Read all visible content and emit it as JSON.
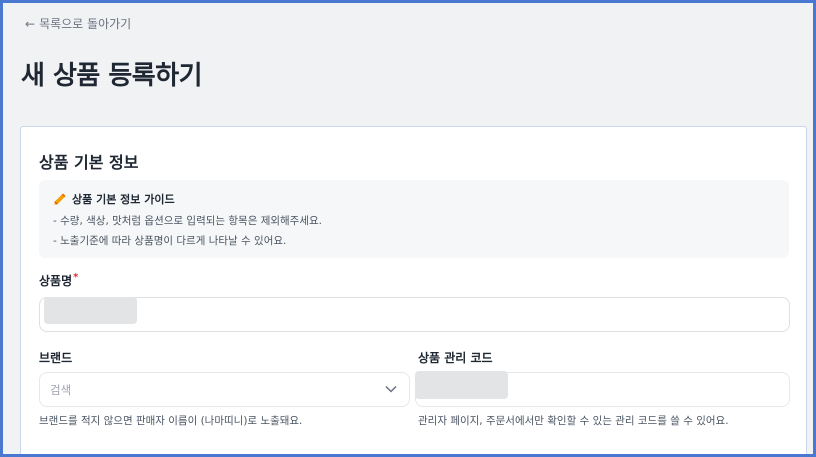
{
  "nav": {
    "back_arrow": "←",
    "back_label": "목록으로 돌아가기"
  },
  "page": {
    "title": "새 상품 등록하기"
  },
  "section": {
    "title": "상품 기본 정보",
    "guide": {
      "icon": "pencil-icon",
      "title": "상품 기본 정보 가이드",
      "lines": [
        "- 수량, 색상, 맛처럼 옵션으로 입력되는 항목은 제외해주세요.",
        "- 노출기준에 따라 상품명이 다르게 나타날 수 있어요."
      ]
    }
  },
  "fields": {
    "product_name": {
      "label": "상품명",
      "required_mark": "*"
    },
    "brand": {
      "label": "브랜드",
      "placeholder": "검색",
      "help": "브랜드를 적지 않으면 판매자 이름이 (나마띠니)로 노출돼요."
    },
    "product_code": {
      "label": "상품 관리 코드",
      "help": "관리자 페이지, 주문서에서만 확인할 수 있는 관리 코드를 쓸 수 있어요."
    }
  },
  "colors": {
    "frame_border": "#4a78d0",
    "background": "#f1f2f4",
    "required": "#e03131",
    "guide_icon": "#f59f00"
  }
}
